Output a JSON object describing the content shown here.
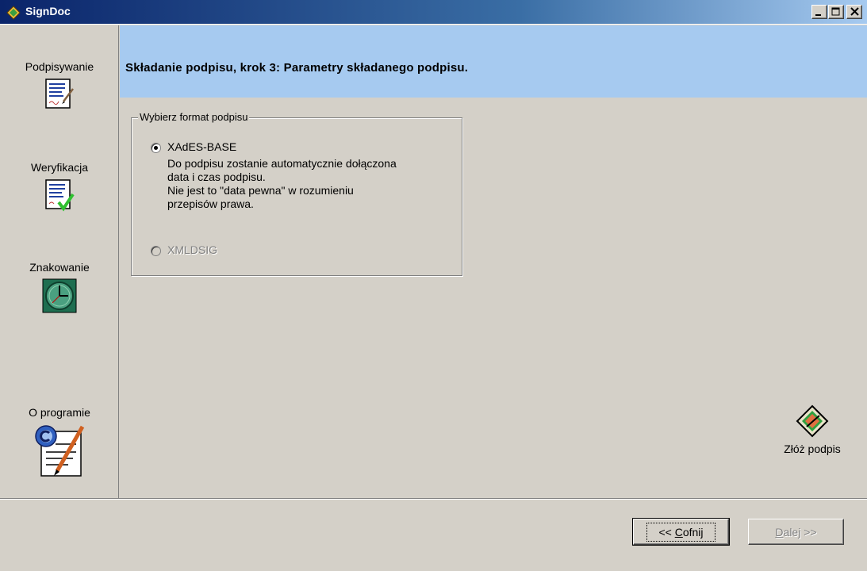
{
  "window": {
    "title": "SignDoc",
    "controls": {
      "minimize": "_",
      "maximize": "□",
      "close": "×"
    }
  },
  "sidebar": {
    "items": [
      {
        "label": "Podpisywanie",
        "icon": "document-sign-icon"
      },
      {
        "label": "Weryfikacja",
        "icon": "document-verify-icon"
      },
      {
        "label": "Znakowanie",
        "icon": "clock-icon"
      },
      {
        "label": "O programie",
        "icon": "about-certificate-icon"
      }
    ]
  },
  "header": {
    "heading": "Składanie podpisu, krok 3: Parametry składanego podpisu."
  },
  "format_group": {
    "legend": "Wybierz format podpisu",
    "options": [
      {
        "label": "XAdES-BASE",
        "checked": true,
        "enabled": true
      },
      {
        "label": "XMLDSIG",
        "checked": false,
        "enabled": false
      }
    ],
    "description": [
      "Do podpisu zostanie automatycznie dołączona",
      "data i czas podpisu.",
      "Nie jest to \"data pewna\" w rozumieniu",
      "przepisów prawa."
    ]
  },
  "sign_action": {
    "label": "Złóż podpis",
    "icon": "sign-diamond-icon"
  },
  "buttons": {
    "back": {
      "prefix": "<< ",
      "accel": "C",
      "rest": "ofnij"
    },
    "next": {
      "accel": "D",
      "rest": "alej >>"
    }
  },
  "colors": {
    "titlebar_start": "#0a246a",
    "header_band": "#a6caf0",
    "face": "#d4d0c8"
  }
}
